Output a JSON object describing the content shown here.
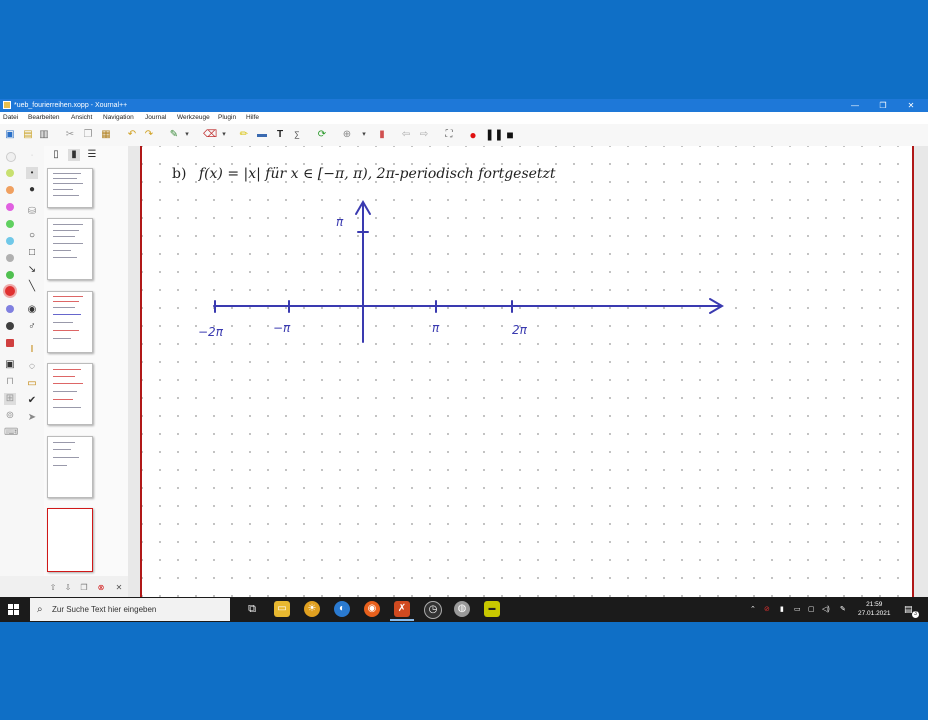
{
  "window": {
    "title": "*ueb_fourierreihen.xopp - Xournal++",
    "controls": [
      "—",
      "❐",
      "✕"
    ]
  },
  "menu": [
    "Datei",
    "Bearbeiten",
    "Ansicht",
    "Navigation",
    "Journal",
    "Werkzeuge",
    "Plugin",
    "Hilfe"
  ],
  "toolbar": {
    "icons": [
      "new-document-icon",
      "open-icon",
      "save-icon",
      "cut-icon",
      "copy-icon",
      "paste-icon",
      "undo-icon",
      "redo-icon",
      "pen-tool-icon",
      "eraser-icon",
      "highlighter-icon",
      "image-icon",
      "text-tool-icon",
      "tex-icon",
      "refresh-icon",
      "zoom-icon",
      "delete-page-icon",
      "back-icon",
      "forward-icon",
      "fullscreen-icon",
      "record-icon",
      "pause-icon",
      "stop-icon"
    ],
    "text_glyph": "T"
  },
  "palette": {
    "colors": [
      "#f0f0f0",
      "#c8e070",
      "#f0a060",
      "#e060e0",
      "#60d060",
      "#70c8e8",
      "#b0b0b0",
      "#50c050",
      "#e03030",
      "#8080e0",
      "#404040",
      "#d04040"
    ]
  },
  "previews": {
    "pages": 6,
    "selected_page": 6
  },
  "document": {
    "formula_label": "b)",
    "formula": "f(x) = |x| für x ∈ [−π, π), 2π-periodisch fortgesetzt",
    "ink_color": "#3a3ab0",
    "y_axis_label": "π",
    "x_tick_labels": [
      "−2π",
      "−π",
      "π",
      "2π"
    ]
  },
  "taskbar": {
    "search_placeholder": "Zur Suche Text hier eingeben",
    "apps": [
      "task-view-icon",
      "file-explorer-icon",
      "app-icon",
      "app-icon",
      "firefox-icon",
      "xournal-icon",
      "app-icon",
      "app-icon",
      "app-icon"
    ],
    "time": "21:59",
    "date": "27.01.2021",
    "notification_count": "3"
  }
}
